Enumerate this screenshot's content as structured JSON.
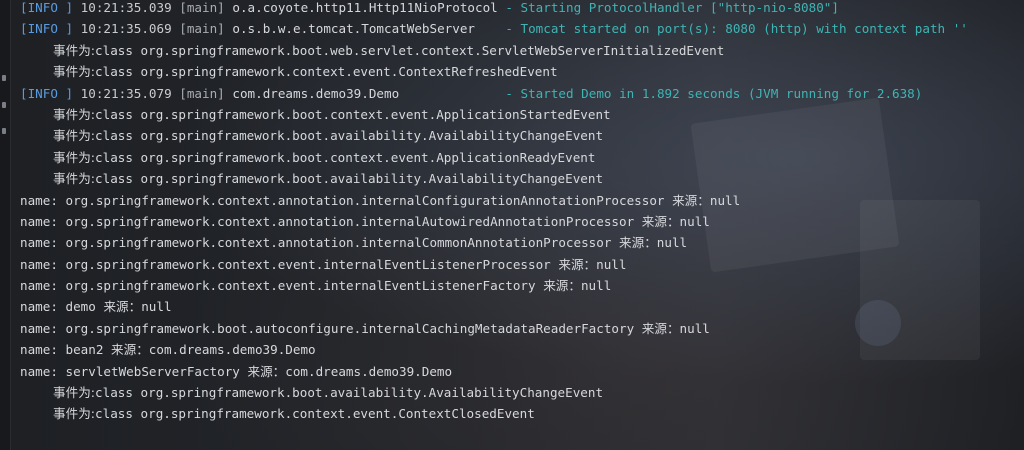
{
  "console": {
    "lines": [
      {
        "level": "[INFO ]",
        "time": "10:21:35.039",
        "thread": "[main]",
        "logger": "o.a.coyote.http11.Http11NioProtocol",
        "pad": " ",
        "sep": "- ",
        "message": "Starting ProtocolHandler [\"http-nio-8080\"]"
      },
      {
        "level": "[INFO ]",
        "time": "10:21:35.069",
        "thread": "[main]",
        "logger": "o.s.b.w.e.tomcat.TomcatWebServer",
        "pad": "    ",
        "sep": "- ",
        "message": "Tomcat started on port(s): 8080 (http) with context path ''"
      },
      {
        "label": "事件为:",
        "text": "class org.springframework.boot.web.servlet.context.ServletWebServerInitializedEvent"
      },
      {
        "label": "事件为:",
        "text": "class org.springframework.context.event.ContextRefreshedEvent"
      },
      {
        "level": "[INFO ]",
        "time": "10:21:35.079",
        "thread": "[main]",
        "logger": "com.dreams.demo39.Demo",
        "pad": "              ",
        "sep": "- ",
        "message": "Started Demo in 1.892 seconds (JVM running for 2.638)"
      },
      {
        "label": "事件为:",
        "text": "class org.springframework.boot.context.event.ApplicationStartedEvent"
      },
      {
        "label": "事件为:",
        "text": "class org.springframework.boot.availability.AvailabilityChangeEvent"
      },
      {
        "label": "事件为:",
        "text": "class org.springframework.boot.context.event.ApplicationReadyEvent"
      },
      {
        "label": "事件为:",
        "text": "class org.springframework.boot.availability.AvailabilityChangeEvent"
      },
      {
        "name": "org.springframework.context.annotation.internalConfigurationAnnotationProcessor",
        "source_label": "来源：",
        "source": "null"
      },
      {
        "name": "org.springframework.context.annotation.internalAutowiredAnnotationProcessor",
        "source_label": "来源：",
        "source": "null"
      },
      {
        "name": "org.springframework.context.annotation.internalCommonAnnotationProcessor",
        "source_label": "来源：",
        "source": "null"
      },
      {
        "name": "org.springframework.context.event.internalEventListenerProcessor",
        "source_label": "来源：",
        "source": "null"
      },
      {
        "name": "org.springframework.context.event.internalEventListenerFactory",
        "source_label": "来源：",
        "source": "null"
      },
      {
        "name": "demo",
        "source_label": "来源：",
        "source": "null"
      },
      {
        "name": "org.springframework.boot.autoconfigure.internalCachingMetadataReaderFactory",
        "source_label": "来源：",
        "source": "null"
      },
      {
        "name": "bean2",
        "source_label": "来源：",
        "source": "com.dreams.demo39.Demo"
      },
      {
        "name": "servletWebServerFactory",
        "source_label": "来源：",
        "source": "com.dreams.demo39.Demo"
      },
      {
        "label": "事件为:",
        "text": "class org.springframework.boot.availability.AvailabilityChangeEvent"
      },
      {
        "label": "事件为:",
        "text": "class org.springframework.context.event.ContextClosedEvent"
      }
    ],
    "name_prefix": "name: "
  },
  "colors": {
    "info": "#5a9be0",
    "message": "#3fb4b4",
    "text": "#d6d8dc",
    "background": "#1c1e22"
  }
}
